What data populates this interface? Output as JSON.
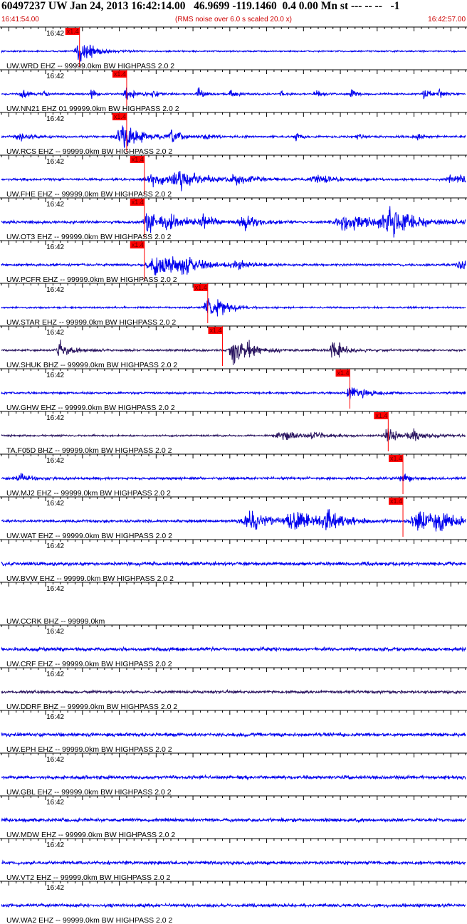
{
  "header": {
    "title": "60497237 UW Jan 24, 2013 16:42:14.00   46.9699 -119.1460  0.4 0.00 Mn st --- -- --   -1",
    "start_time": "16:41:54.00",
    "note": "(RMS noise over 6.0 s scaled 20.0 x)",
    "end_time": "16:42:57.00"
  },
  "colors": {
    "trace": "#0000ee",
    "trace_dark": "#2a1560",
    "pick": "#ff0000",
    "text": "#000000",
    "header_red": "#cc0000"
  },
  "chart_data": {
    "type": "line",
    "description_units": "seconds",
    "xlim": [
      54.0,
      117.0
    ],
    "time_tick_label": "16:42",
    "pick_label": "x1.4",
    "channels": [
      {
        "label": "UW.WRD EHZ -- 99999.0km BW  HIGHPASS  2.0  2",
        "pick": 64.6,
        "color": "blue",
        "noise": 0.05,
        "events": [
          [
            64.6,
            0.95,
            1.2
          ],
          [
            66.3,
            0.22,
            2.0
          ]
        ]
      },
      {
        "label": "UW.NN21 EHZ 01 99999.0km BW  HIGHPASS  2.0  2",
        "pick": 71.0,
        "color": "blue",
        "noise": 0.06,
        "events": [
          [
            56.7,
            0.35,
            0.8
          ],
          [
            59.7,
            0.22,
            0.6
          ],
          [
            66.3,
            0.3,
            0.6
          ],
          [
            71.0,
            0.55,
            1.0
          ],
          [
            74.7,
            0.22,
            0.8
          ],
          [
            80.8,
            0.32,
            0.8
          ],
          [
            85.2,
            0.32,
            0.8
          ],
          [
            92.0,
            0.24,
            0.6
          ],
          [
            96.7,
            0.24,
            0.8
          ],
          [
            101.5,
            0.3,
            0.6
          ],
          [
            111.5,
            0.4,
            0.8
          ],
          [
            113.5,
            0.24,
            0.6
          ]
        ]
      },
      {
        "label": "UW.RCS EHZ -- 99999.0km BW  HIGHPASS  2.0  2",
        "pick": 71.0,
        "color": "blue",
        "noise": 0.07,
        "events": [
          [
            56.3,
            0.25,
            1.5
          ],
          [
            70.5,
            0.85,
            2.5
          ],
          [
            77.2,
            0.4,
            1.0
          ],
          [
            81.5,
            0.22,
            0.8
          ],
          [
            94.0,
            0.2,
            0.8
          ],
          [
            102.5,
            0.22,
            0.8
          ],
          [
            110.5,
            0.2,
            0.8
          ]
        ]
      },
      {
        "label": "UW.FHE EHZ -- 99999.0km BW  HIGHPASS  2.0  2",
        "pick": 73.4,
        "color": "blue",
        "noise": 0.08,
        "events": [
          [
            74.5,
            0.45,
            2.5
          ],
          [
            78.4,
            0.65,
            3.0
          ],
          [
            86.0,
            0.3,
            2.0
          ],
          [
            97.0,
            0.25,
            2.5
          ],
          [
            115.5,
            0.35,
            2.5
          ]
        ]
      },
      {
        "label": "UW.OT3 EHZ -- 99999.0km BW  HIGHPASS  2.0  2",
        "pick": 73.4,
        "color": "blue",
        "noise": 0.09,
        "events": [
          [
            74.0,
            0.75,
            1.5
          ],
          [
            77.0,
            0.45,
            2.5
          ],
          [
            81.5,
            0.4,
            1.5
          ],
          [
            87.0,
            0.45,
            2.0
          ],
          [
            101.0,
            0.5,
            4.0
          ],
          [
            107.0,
            0.85,
            3.5
          ]
        ]
      },
      {
        "label": "UW.PCFR EHZ -- 99999.0km BW  HIGHPASS  2.0  2",
        "pick": 73.4,
        "color": "blue",
        "noise": 0.08,
        "events": [
          [
            75.0,
            0.85,
            3.0
          ],
          [
            79.0,
            0.35,
            2.5
          ],
          [
            86.0,
            0.22,
            2.0
          ],
          [
            116.5,
            0.4,
            1.5
          ]
        ]
      },
      {
        "label": "UW.STAR EHZ -- 99999.0km BW  HIGHPASS  2.0  2",
        "pick": 82.0,
        "color": "blue",
        "noise": 0.06,
        "events": [
          [
            82.0,
            0.95,
            1.2
          ],
          [
            83.5,
            0.35,
            2.0
          ]
        ]
      },
      {
        "label": "UW.SHUK BHZ -- 99999.0km BW  HIGHPASS  2.0  2",
        "pick": 84.0,
        "color": "dark",
        "noise": 0.07,
        "events": [
          [
            62.0,
            0.55,
            1.5
          ],
          [
            85.5,
            0.95,
            1.3
          ],
          [
            87.5,
            0.35,
            2.0
          ],
          [
            98.9,
            0.95,
            0.7
          ],
          [
            100.0,
            0.3,
            1.5
          ]
        ]
      },
      {
        "label": "UW.GHW EHZ -- 99999.0km BW  HIGHPASS  2.0  2",
        "pick": 101.3,
        "color": "blue",
        "noise": 0.07,
        "events": [
          [
            101.3,
            0.5,
            1.0
          ],
          [
            103.0,
            0.2,
            1.5
          ]
        ]
      },
      {
        "label": "TA.F05D BHZ -- 99999.0km BW  HIGHPASS  2.0  2",
        "pick": 106.5,
        "color": "dark",
        "noise": 0.06,
        "events": [
          [
            92.0,
            0.35,
            2.5
          ],
          [
            96.5,
            0.25,
            1.5
          ],
          [
            106.5,
            0.6,
            1.5
          ],
          [
            110.0,
            0.35,
            2.0
          ]
        ]
      },
      {
        "label": "UW.MJ2 EHZ -- 99999.0km BW  HIGHPASS  2.0  2",
        "pick": 108.5,
        "color": "blue",
        "noise": 0.09,
        "events": [
          [
            56.5,
            0.25,
            1.5
          ],
          [
            108.5,
            0.25,
            1.0
          ]
        ]
      },
      {
        "label": "UW.WAT EHZ -- 99999.0km BW  HIGHPASS  2.0  2",
        "pick": 108.5,
        "color": "blue",
        "noise": 0.09,
        "events": [
          [
            88.0,
            0.55,
            4.0
          ],
          [
            94.0,
            0.75,
            3.0
          ],
          [
            98.5,
            0.55,
            2.0
          ],
          [
            110.5,
            0.85,
            2.0
          ],
          [
            113.5,
            0.75,
            2.0
          ]
        ]
      },
      {
        "label": "UW.BVW EHZ -- 99999.0km BW  HIGHPASS  2.0  2",
        "pick": null,
        "color": "blue",
        "noise": 0.12,
        "events": []
      },
      {
        "label": "UW.CCRK BHZ -- 99999.0km",
        "pick": null,
        "color": "none",
        "noise": 0.0,
        "events": []
      },
      {
        "label": "UW.CRF EHZ -- 99999.0km BW  HIGHPASS  2.0  2",
        "pick": null,
        "color": "blue",
        "noise": 0.12,
        "events": []
      },
      {
        "label": "UW.DDRF BHZ -- 99999.0km BW  HIGHPASS  2.0  2",
        "pick": null,
        "color": "dark",
        "noise": 0.1,
        "events": []
      },
      {
        "label": "UW.EPH EHZ -- 99999.0km BW  HIGHPASS  2.0  2",
        "pick": null,
        "color": "blue",
        "noise": 0.12,
        "events": []
      },
      {
        "label": "UW.GBL EHZ -- 99999.0km BW  HIGHPASS  2.0  2",
        "pick": null,
        "color": "blue",
        "noise": 0.12,
        "events": []
      },
      {
        "label": "UW.MDW EHZ -- 99999.0km BW  HIGHPASS  2.0  2",
        "pick": null,
        "color": "blue",
        "noise": 0.12,
        "events": []
      },
      {
        "label": "UW.VT2 EHZ -- 99999.0km BW  HIGHPASS  2.0  2",
        "pick": null,
        "color": "blue",
        "noise": 0.12,
        "events": []
      },
      {
        "label": "UW.WA2 EHZ -- 99999.0km BW  HIGHPASS  2.0  2",
        "pick": null,
        "color": "blue",
        "noise": 0.12,
        "events": []
      }
    ]
  }
}
